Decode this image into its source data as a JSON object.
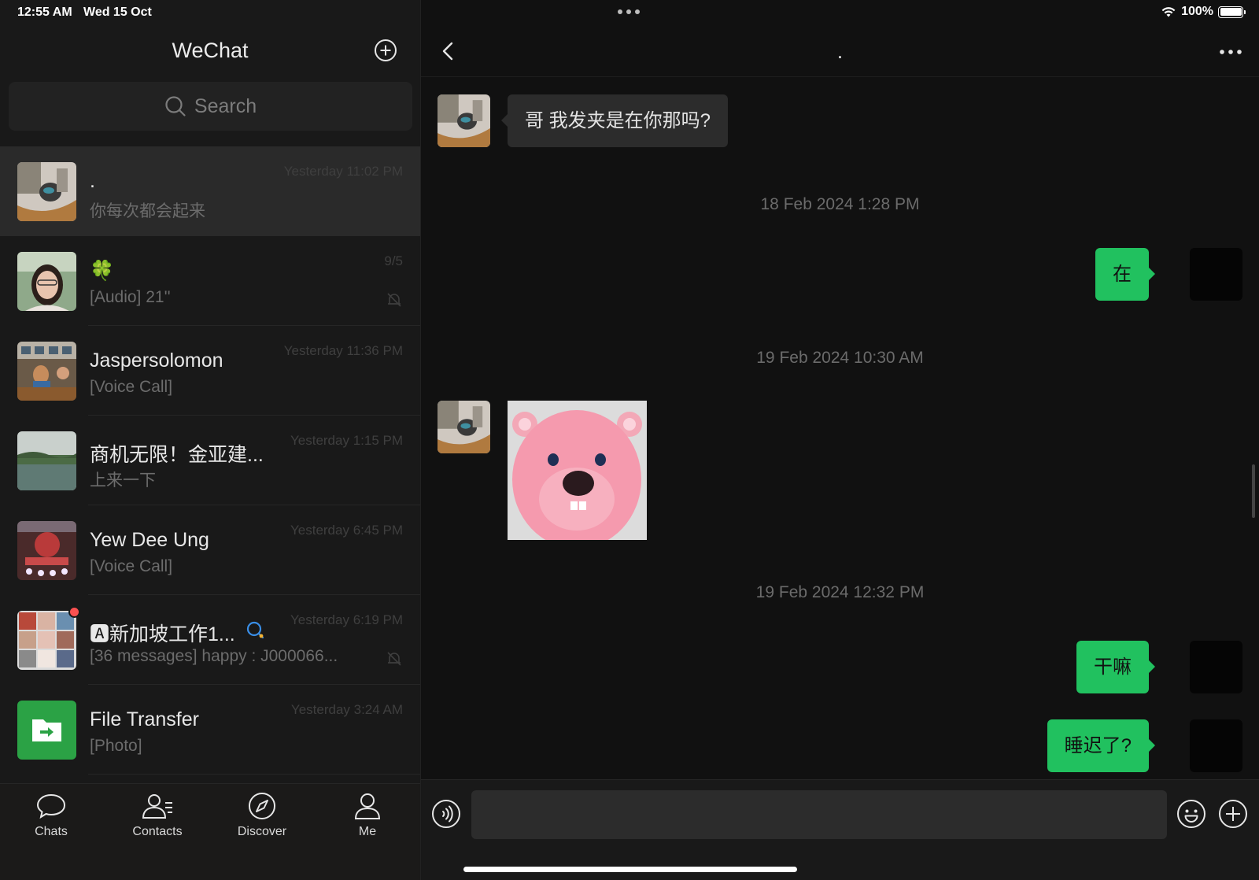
{
  "status_bar": {
    "time": "12:55 AM",
    "date": "Wed 15 Oct",
    "battery": "100%",
    "battery_level": 1.0
  },
  "sidebar": {
    "title": "WeChat",
    "search": {
      "placeholder": "Search"
    },
    "chats": [
      {
        "name": ".",
        "time": "Yesterday 11:02 PM",
        "preview": "你每次都会起来",
        "active": true,
        "muted": false
      },
      {
        "name": "🍀",
        "time": "9/5",
        "preview": "[Audio]  21''",
        "active": false,
        "muted": true
      },
      {
        "name": "Jaspersolomon",
        "time": "Yesterday 11:36 PM",
        "preview": "[Voice Call]",
        "active": false,
        "muted": false
      },
      {
        "name": "商机无限！金亚建...",
        "time": "Yesterday 1:15 PM",
        "preview": "上来一下",
        "active": false,
        "muted": false
      },
      {
        "name": "Yew Dee Ung",
        "time": "Yesterday 6:45 PM",
        "preview": "[Voice Call]",
        "active": false,
        "muted": false
      },
      {
        "name": "🅰新加坡工作1...",
        "time": "Yesterday 6:19 PM",
        "preview": "[36 messages] happy : J000066...",
        "active": false,
        "muted": true,
        "unread_dot": true
      },
      {
        "name": "File Transfer",
        "time": "Yesterday 3:24 AM",
        "preview": "[Photo]",
        "active": false,
        "muted": false
      }
    ],
    "tabs": [
      {
        "label": "Chats",
        "icon": "chat-bubble-icon"
      },
      {
        "label": "Contacts",
        "icon": "contacts-icon"
      },
      {
        "label": "Discover",
        "icon": "compass-icon"
      },
      {
        "label": "Me",
        "icon": "person-icon"
      }
    ]
  },
  "conversation": {
    "title": ".",
    "messages": [
      {
        "type": "text",
        "direction": "in",
        "text": "哥 我发夹是在你那吗?"
      },
      {
        "type": "timestamp",
        "text": "18 Feb 2024 1:28 PM"
      },
      {
        "type": "text",
        "direction": "out",
        "text": "在"
      },
      {
        "type": "timestamp",
        "text": "19 Feb 2024 10:30 AM"
      },
      {
        "type": "sticker",
        "direction": "in",
        "icon": "pink-beaver-sticker"
      },
      {
        "type": "timestamp",
        "text": "19 Feb 2024 12:32 PM"
      },
      {
        "type": "text",
        "direction": "out",
        "text": "干嘛"
      },
      {
        "type": "text",
        "direction": "out",
        "text": "睡迟了?"
      }
    ],
    "input": {
      "value": "",
      "placeholder": ""
    }
  },
  "colors": {
    "accent_green": "#21C15F",
    "background": "#111111",
    "panel": "#191919",
    "unread": "#FA5151"
  }
}
